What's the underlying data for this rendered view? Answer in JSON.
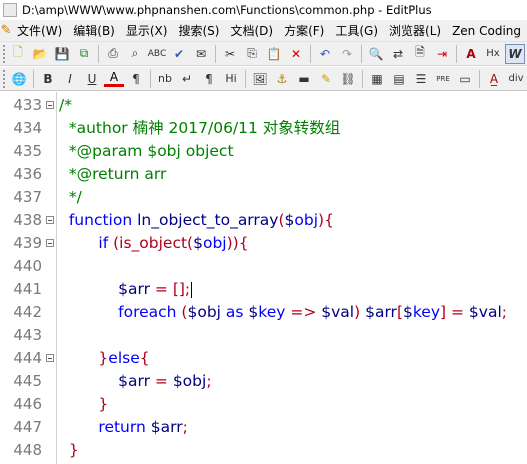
{
  "window": {
    "title": "D:\\amp\\WWW\\www.phpnanshen.com\\Functions\\common.php - EditPlus"
  },
  "menu": [
    "文件(W)",
    "编辑(B)",
    "显示(X)",
    "搜索(S)",
    "文档(D)",
    "方案(F)",
    "工具(G)",
    "浏览器(L)",
    "Zen Coding"
  ],
  "toolbar2": {
    "nb": "nb",
    "hi": "Hi",
    "hx": "Hx",
    "pre": "PRE",
    "div": "div"
  },
  "editor": {
    "lines": [
      {
        "n": "433",
        "fold": true,
        "segs": [
          {
            "t": "/*",
            "c": "c"
          }
        ]
      },
      {
        "n": "434",
        "fold": false,
        "segs": [
          {
            "t": "  *author 楠神 2017/06/11 对象转数组",
            "c": "c"
          }
        ]
      },
      {
        "n": "435",
        "fold": false,
        "segs": [
          {
            "t": "  *@param $obj object",
            "c": "c"
          }
        ]
      },
      {
        "n": "436",
        "fold": false,
        "segs": [
          {
            "t": "  *@return arr",
            "c": "c"
          }
        ]
      },
      {
        "n": "437",
        "fold": false,
        "segs": [
          {
            "t": "  */",
            "c": "c"
          }
        ]
      },
      {
        "n": "438",
        "fold": true,
        "segs": [
          {
            "t": "  function ",
            "c": "k"
          },
          {
            "t": "ln_object_to_array",
            "c": "v"
          },
          {
            "t": "(",
            "c": "r"
          },
          {
            "t": "$",
            "c": "v"
          },
          {
            "t": "obj",
            "c": "k"
          },
          {
            "t": "){",
            "c": "r"
          }
        ]
      },
      {
        "n": "439",
        "fold": true,
        "segs": [
          {
            "t": "        if ",
            "c": "k"
          },
          {
            "t": "(is_object(",
            "c": "r"
          },
          {
            "t": "$",
            "c": "v"
          },
          {
            "t": "obj",
            "c": "k"
          },
          {
            "t": ")){",
            "c": "r"
          }
        ]
      },
      {
        "n": "440",
        "fold": false,
        "segs": []
      },
      {
        "n": "441",
        "fold": false,
        "segs": [
          {
            "t": "            $",
            "c": "v"
          },
          {
            "t": "arr",
            "c": "v"
          },
          {
            "t": " = ",
            "c": "r"
          },
          {
            "t": "[];",
            "c": "r"
          },
          {
            "t": "",
            "c": "caret"
          }
        ]
      },
      {
        "n": "442",
        "fold": false,
        "segs": [
          {
            "t": "            foreach ",
            "c": "k"
          },
          {
            "t": "(",
            "c": "r"
          },
          {
            "t": "$obj",
            "c": "v"
          },
          {
            "t": " as ",
            "c": "k"
          },
          {
            "t": "$",
            "c": "v"
          },
          {
            "t": "key",
            "c": "k"
          },
          {
            "t": " => ",
            "c": "r"
          },
          {
            "t": "$val",
            "c": "v"
          },
          {
            "t": ") ",
            "c": "r"
          },
          {
            "t": "$arr",
            "c": "v"
          },
          {
            "t": "[",
            "c": "r"
          },
          {
            "t": "$",
            "c": "v"
          },
          {
            "t": "key",
            "c": "k"
          },
          {
            "t": "] = ",
            "c": "r"
          },
          {
            "t": "$val",
            "c": "v"
          },
          {
            "t": ";",
            "c": "r"
          }
        ]
      },
      {
        "n": "443",
        "fold": false,
        "segs": []
      },
      {
        "n": "444",
        "fold": true,
        "segs": [
          {
            "t": "        }",
            "c": "r"
          },
          {
            "t": "else",
            "c": "k"
          },
          {
            "t": "{",
            "c": "r"
          }
        ]
      },
      {
        "n": "445",
        "fold": false,
        "segs": [
          {
            "t": "            $arr",
            "c": "v"
          },
          {
            "t": " = ",
            "c": "r"
          },
          {
            "t": "$obj",
            "c": "v"
          },
          {
            "t": ";",
            "c": "r"
          }
        ]
      },
      {
        "n": "446",
        "fold": false,
        "segs": [
          {
            "t": "        }",
            "c": "r"
          }
        ]
      },
      {
        "n": "447",
        "fold": false,
        "segs": [
          {
            "t": "        return ",
            "c": "k"
          },
          {
            "t": "$arr",
            "c": "v"
          },
          {
            "t": ";",
            "c": "r"
          }
        ]
      },
      {
        "n": "448",
        "fold": false,
        "segs": [
          {
            "t": "  }",
            "c": "r"
          }
        ]
      }
    ]
  }
}
